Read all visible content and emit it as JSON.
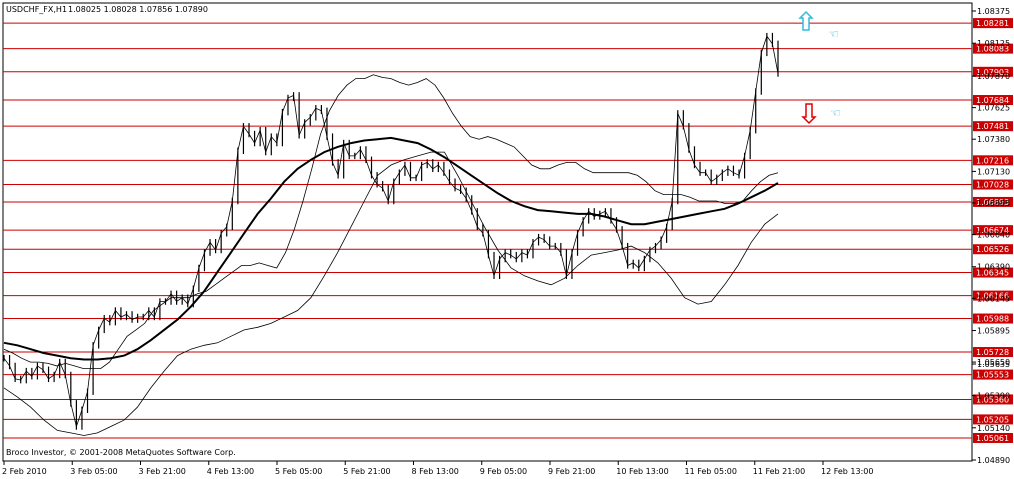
{
  "header": {
    "symbol": "USDCHF_FX,H1",
    "ohlc": "1.08025 1.08028 1.07856 1.07890"
  },
  "copyright": "Broco Investor, © 2001-2008 MetaQuotes Software Corp.",
  "colors": {
    "level_line": "#cc0000",
    "level_box": "#cc0000",
    "up_arrow": "#33bbdd",
    "down_arrow": "#dd0000",
    "candles": "#000000",
    "bands": "#000000",
    "grid": "#000000"
  },
  "icons": [
    "up-arrow-icon",
    "down-arrow-icon",
    "hand-pointer-icon"
  ],
  "chart_data": {
    "type": "candlestick",
    "symbol": "USDCHF_FX",
    "timeframe": "H1",
    "y_ticks": [
      1.08375,
      1.08125,
      1.0787,
      1.07625,
      1.0738,
      1.0713,
      1.06885,
      1.0664,
      1.0639,
      1.06145,
      1.05895,
      1.0565,
      1.05635,
      1.0539,
      1.0514,
      1.0489
    ],
    "y_tick_labels": [
      "1.08375",
      "1.08125",
      "1.07870",
      "1.07625",
      "1.07380",
      "1.07130",
      "1.06885",
      "1.06640",
      "1.06390",
      "1.06145",
      "1.05895",
      "1.05650",
      "1.05635",
      "1.05390",
      "1.05140",
      "1.04890"
    ],
    "x_labels": [
      "2 Feb 2010",
      "3 Feb 05:00",
      "3 Feb 21:00",
      "4 Feb 13:00",
      "5 Feb 05:00",
      "5 Feb 21:00",
      "8 Feb 13:00",
      "9 Feb 05:00",
      "9 Feb 21:00",
      "10 Feb 13:00",
      "11 Feb 05:00",
      "11 Feb 21:00",
      "12 Feb 13:00"
    ],
    "levels": [
      "1.08281",
      "1.08083",
      "1.07903",
      "1.07684",
      "1.07481",
      "1.07216",
      "1.07028",
      "1.06893",
      "1.06674",
      "1.06526",
      "1.06345",
      "1.06166",
      "1.05988",
      "1.05728",
      "1.05553",
      "1.05360",
      "1.05205",
      "1.05061"
    ],
    "close": [
      1.0568,
      1.0562,
      1.0552,
      1.0551,
      1.0558,
      1.0554,
      1.0562,
      1.0559,
      1.0552,
      1.0555,
      1.0565,
      1.0555,
      1.0533,
      1.0515,
      1.0528,
      1.0542,
      1.0578,
      1.059,
      1.0599,
      1.0596,
      1.0605,
      1.06,
      1.0602,
      1.0598,
      1.06,
      1.06,
      1.0605,
      1.06,
      1.0612,
      1.0612,
      1.0618,
      1.0612,
      1.0615,
      1.061,
      1.0622,
      1.0638,
      1.065,
      1.0658,
      1.0652,
      1.0665,
      1.067,
      1.069,
      1.0729,
      1.0748,
      1.0742,
      1.0735,
      1.0745,
      1.0728,
      1.074,
      1.0735,
      1.0759,
      1.077,
      1.0772,
      1.0741,
      1.0751,
      1.0755,
      1.0762,
      1.076,
      1.074,
      1.072,
      1.071,
      1.0735,
      1.0725,
      1.0725,
      1.073,
      1.0722,
      1.071,
      1.0703,
      1.07,
      1.069,
      1.0705,
      1.0712,
      1.0718,
      1.0708,
      1.0708,
      1.0718,
      1.072,
      1.0715,
      1.0718,
      1.0712,
      1.0705,
      1.07,
      1.0698,
      1.0692,
      1.0682,
      1.067,
      1.0665,
      1.0648,
      1.0632,
      1.0645,
      1.065,
      1.0648,
      1.0645,
      1.065,
      1.0648,
      1.0658,
      1.0662,
      1.066,
      1.0655,
      1.0655,
      1.065,
      1.0632,
      1.065,
      1.0665,
      1.0675,
      1.0682,
      1.0678,
      1.068,
      1.0682,
      1.0675,
      1.0668,
      1.0655,
      1.064,
      1.0642,
      1.0638,
      1.0645,
      1.0652,
      1.0655,
      1.066,
      1.067,
      1.069,
      1.0758,
      1.0748,
      1.073,
      1.0718,
      1.0712,
      1.0712,
      1.0705,
      1.0708,
      1.0712,
      1.0715,
      1.0712,
      1.071,
      1.0725,
      1.0745,
      1.0775,
      1.0805,
      1.0818,
      1.0812,
      1.0789
    ],
    "bb_upper": [
      1.0575,
      1.0572,
      1.0568,
      1.0565,
      1.0565,
      1.0564,
      1.0562,
      1.0564,
      1.0562,
      1.056,
      1.056,
      1.056,
      1.0565,
      1.0575,
      1.0585,
      1.059,
      1.0595,
      1.0605,
      1.061,
      1.0615,
      1.0615,
      1.0615,
      1.0618,
      1.062,
      1.0625,
      1.063,
      1.0635,
      1.064,
      1.064,
      1.0642,
      1.064,
      1.0638,
      1.065,
      1.0668,
      1.069,
      1.0715,
      1.0742,
      1.076,
      1.0772,
      1.078,
      1.0785,
      1.0785,
      1.0788,
      1.0786,
      1.0785,
      1.0782,
      1.078,
      1.0782,
      1.0785,
      1.078,
      1.077,
      1.0758,
      1.0748,
      1.074,
      1.0738,
      1.074,
      1.0738,
      1.0735,
      1.0732,
      1.0725,
      1.0718,
      1.0715,
      1.0715,
      1.0718,
      1.072,
      1.072,
      1.0715,
      1.0712,
      1.0712,
      1.0712,
      1.0712,
      1.0712,
      1.071,
      1.0705,
      1.0698,
      1.0695,
      1.0695,
      1.0695,
      1.0693,
      1.069,
      1.069,
      1.069,
      1.0688,
      1.0688,
      1.069,
      1.0698,
      1.0705,
      1.071,
      1.0712
    ],
    "bb_lower": [
      1.0545,
      1.0538,
      1.053,
      1.052,
      1.0512,
      1.051,
      1.0508,
      1.051,
      1.0515,
      1.052,
      1.053,
      1.0545,
      1.0558,
      1.057,
      1.0575,
      1.0578,
      1.058,
      1.0585,
      1.059,
      1.0592,
      1.0595,
      1.06,
      1.0605,
      1.0615,
      1.0632,
      1.065,
      1.067,
      1.069,
      1.071,
      1.0718,
      1.0722,
      1.0725,
      1.0728,
      1.0728,
      1.071,
      1.069,
      1.067,
      1.0652,
      1.0638,
      1.0632,
      1.0628,
      1.0625,
      1.063,
      1.064,
      1.0648,
      1.065,
      1.0652,
      1.0655,
      1.065,
      1.0642,
      1.063,
      1.0615,
      1.061,
      1.0612,
      1.0625,
      1.064,
      1.0658,
      1.0672,
      1.068
    ],
    "ma": [
      1.058,
      1.0578,
      1.0575,
      1.0572,
      1.057,
      1.0568,
      1.0567,
      1.0567,
      1.0568,
      1.057,
      1.0575,
      1.0582,
      1.059,
      1.0598,
      1.0608,
      1.062,
      1.0635,
      1.065,
      1.0665,
      1.068,
      1.0692,
      1.0705,
      1.0715,
      1.0722,
      1.0728,
      1.0732,
      1.0735,
      1.0737,
      1.0738,
      1.0739,
      1.0737,
      1.0735,
      1.073,
      1.0724,
      1.0717,
      1.071,
      1.0703,
      1.0696,
      1.069,
      1.0686,
      1.0683,
      1.0682,
      1.0681,
      1.068,
      1.068,
      1.0678,
      1.0675,
      1.0672,
      1.0672,
      1.0674,
      1.0676,
      1.0678,
      1.068,
      1.0682,
      1.0684,
      1.0688,
      1.0693,
      1.0698,
      1.0704
    ]
  }
}
